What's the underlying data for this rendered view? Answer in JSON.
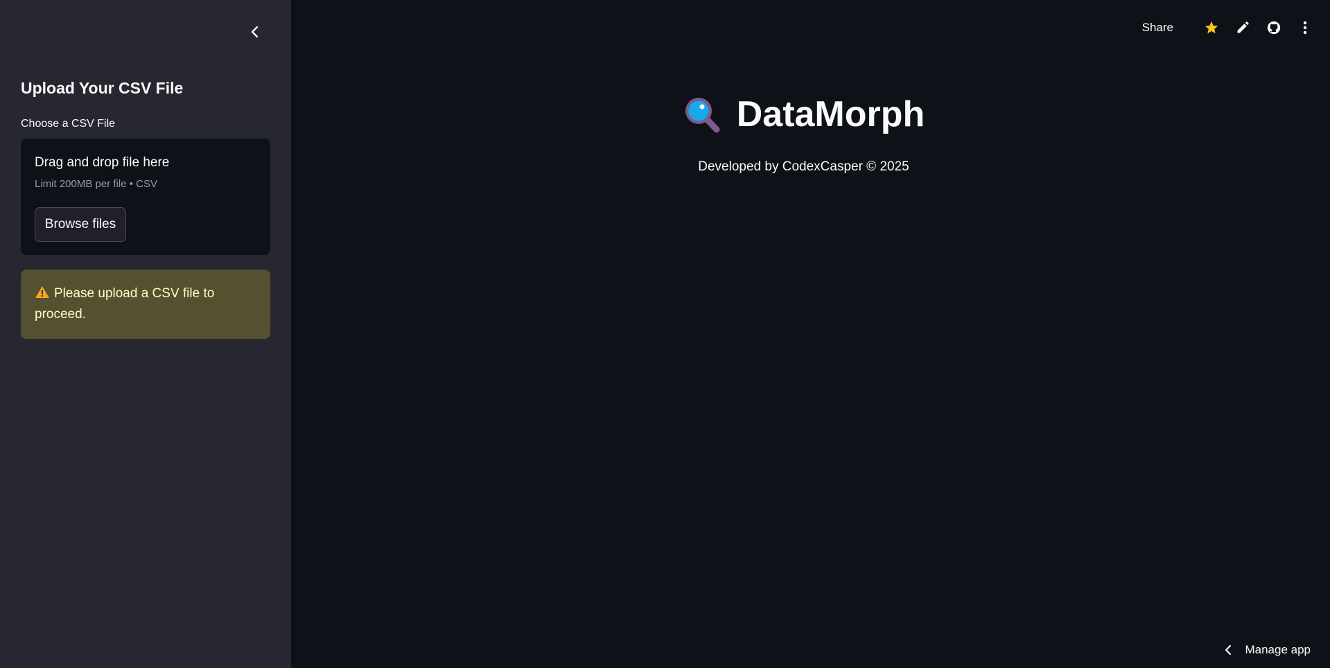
{
  "sidebar": {
    "collapse_icon": "chevron-left-icon",
    "heading": "Upload Your CSV File",
    "uploader": {
      "label": "Choose a CSV File",
      "drop_title": "Drag and drop file here",
      "limit_text": "Limit 200MB per file • CSV",
      "browse_label": "Browse files"
    },
    "warning": {
      "icon": "warning-icon",
      "text": "Please upload a CSV file to proceed."
    }
  },
  "toolbar": {
    "share_label": "Share",
    "icons": [
      "star-icon",
      "pencil-icon",
      "github-icon",
      "kebab-menu-icon"
    ]
  },
  "main": {
    "title_icon": "magnifying-glass-icon",
    "title": "DataMorph",
    "subtitle": "Developed by CodexCasper © 2025"
  },
  "footer": {
    "manage_label": "Manage app"
  },
  "colors": {
    "sidebar_bg": "#262730",
    "main_bg": "#0e1117",
    "warning_bg": "#545030",
    "warning_text": "#ffffc2",
    "star": "#f5c518"
  }
}
